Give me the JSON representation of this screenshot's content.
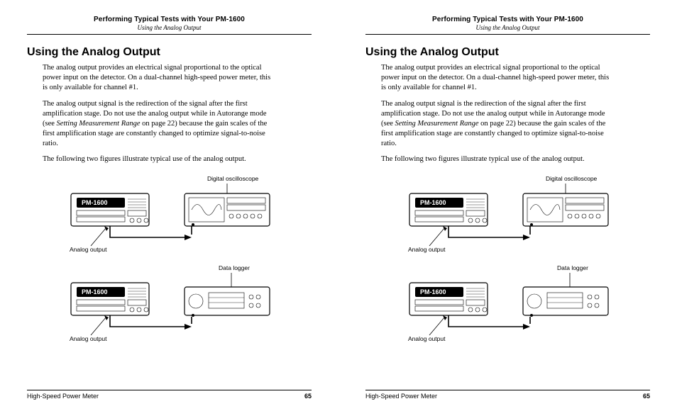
{
  "header": {
    "title": "Performing Typical Tests with Your PM-1600",
    "subtitle": "Using the Analog Output"
  },
  "section": {
    "title": "Using the Analog Output",
    "para1": "The analog output provides an electrical signal proportional to the optical power input on the detector. On a dual-channel high-speed power meter, this is only available for channel #1.",
    "para2a": "The analog output signal is the redirection of the signal after the first amplification stage. Do not use the analog output while in Autorange mode (see ",
    "para2_ital": "Setting Measurement Range",
    "para2b": " on page 22) because the gain scales of the first amplification stage are constantly changed to optimize signal-to-noise ratio.",
    "para3": "The following two figures illustrate typical use of the analog output."
  },
  "figure": {
    "oscilloscope_label": "Digital oscilloscope",
    "datalogger_label": "Data logger",
    "analog_output_label": "Analog output",
    "pm_label": "PM-1600"
  },
  "footer": {
    "left": "High-Speed Power Meter",
    "pagenum": "65"
  }
}
